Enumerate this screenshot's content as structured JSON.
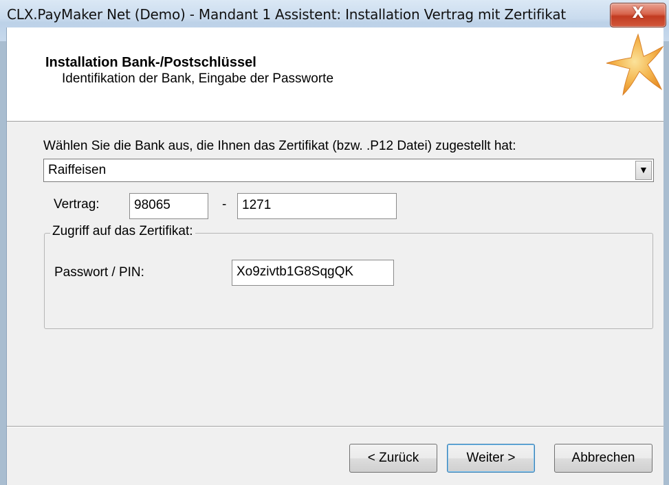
{
  "window": {
    "title": "CLX.PayMaker Net (Demo) - Mandant 1 Assistent: Installation Vertrag mit Zertifikat",
    "close_glyph": "X"
  },
  "header": {
    "title": "Installation Bank-/Postschlüssel",
    "subtitle": "Identifikation der Bank, Eingabe der Passworte",
    "logo_icon": "starfish-icon"
  },
  "form": {
    "bank_prompt": "Wählen Sie die Bank aus, die Ihnen das Zertifikat (bzw. .P12 Datei) zugestellt hat:",
    "bank_selected": "Raiffeisen",
    "contract_label": "Vertrag:",
    "contract_part1": "98065",
    "contract_separator": "-",
    "contract_part2": "1271",
    "group_title": "Zugriff auf das Zertifikat:",
    "password_label": "Passwort / PIN:",
    "password_value": "Xo9zivtb1G8SqgQK"
  },
  "buttons": {
    "back": "< Zurück",
    "next": "Weiter >",
    "cancel": "Abbrechen"
  },
  "colors": {
    "accent_star": "#f2a23a",
    "close_button": "#c8452b"
  }
}
